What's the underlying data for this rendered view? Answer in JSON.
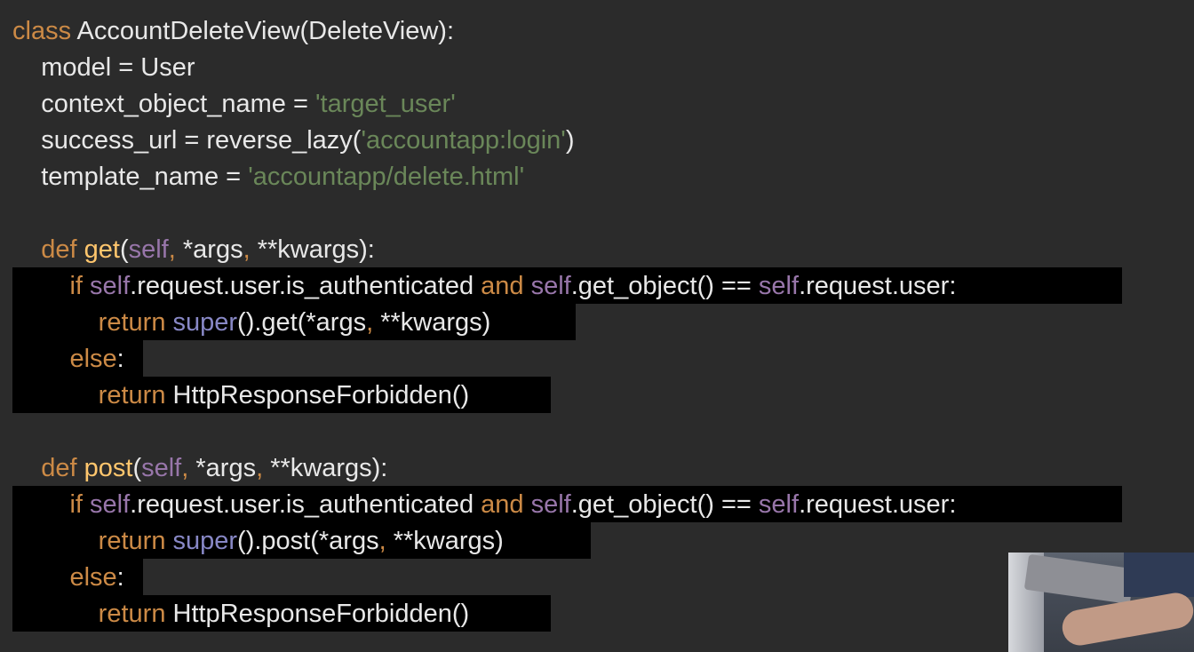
{
  "code_lines": [
    {
      "id": "l01",
      "tokens": [
        {
          "t": "class ",
          "c": "kw"
        },
        {
          "t": "AccountDeleteView(DeleteView):",
          "c": "txt"
        }
      ]
    },
    {
      "id": "l02",
      "tokens": [
        {
          "t": "    model = User",
          "c": "txt"
        }
      ]
    },
    {
      "id": "l03",
      "tokens": [
        {
          "t": "    context_object_name = ",
          "c": "txt"
        },
        {
          "t": "'target_user'",
          "c": "str"
        }
      ]
    },
    {
      "id": "l04",
      "tokens": [
        {
          "t": "    success_url = reverse_lazy(",
          "c": "txt"
        },
        {
          "t": "'accountapp:login'",
          "c": "str"
        },
        {
          "t": ")",
          "c": "txt"
        }
      ]
    },
    {
      "id": "l05",
      "tokens": [
        {
          "t": "    template_name = ",
          "c": "txt"
        },
        {
          "t": "'accountapp/delete.html'",
          "c": "str"
        }
      ]
    },
    {
      "id": "l06",
      "tokens": []
    },
    {
      "id": "l07",
      "tokens": [
        {
          "t": "    def ",
          "c": "kw"
        },
        {
          "t": "get",
          "c": "fn"
        },
        {
          "t": "(",
          "c": "txt"
        },
        {
          "t": "self",
          "c": "self"
        },
        {
          "t": ", ",
          "c": "pun"
        },
        {
          "t": "*args",
          "c": "txt"
        },
        {
          "t": ", ",
          "c": "pun"
        },
        {
          "t": "**kwargs):",
          "c": "txt"
        }
      ]
    },
    {
      "id": "l08",
      "tokens": [
        {
          "t": "        if ",
          "c": "kw"
        },
        {
          "t": "self",
          "c": "self"
        },
        {
          "t": ".request.user.is_authenticated ",
          "c": "txt"
        },
        {
          "t": "and ",
          "c": "kw"
        },
        {
          "t": "self",
          "c": "self"
        },
        {
          "t": ".get_object() == ",
          "c": "txt"
        },
        {
          "t": "self",
          "c": "self"
        },
        {
          "t": ".request.user:",
          "c": "txt"
        }
      ]
    },
    {
      "id": "l09",
      "tokens": [
        {
          "t": "            return ",
          "c": "kw"
        },
        {
          "t": "super",
          "c": "builtin"
        },
        {
          "t": "().get(*args",
          "c": "txt"
        },
        {
          "t": ", ",
          "c": "pun"
        },
        {
          "t": "**kwargs)",
          "c": "txt"
        }
      ]
    },
    {
      "id": "l10",
      "tokens": [
        {
          "t": "        else",
          "c": "kw"
        },
        {
          "t": ":",
          "c": "txt"
        }
      ]
    },
    {
      "id": "l11",
      "tokens": [
        {
          "t": "            return ",
          "c": "kw"
        },
        {
          "t": "HttpResponseForbidden()",
          "c": "txt"
        }
      ]
    },
    {
      "id": "l12",
      "tokens": []
    },
    {
      "id": "l13",
      "tokens": [
        {
          "t": "    def ",
          "c": "kw"
        },
        {
          "t": "post",
          "c": "fn"
        },
        {
          "t": "(",
          "c": "txt"
        },
        {
          "t": "self",
          "c": "self"
        },
        {
          "t": ", ",
          "c": "pun"
        },
        {
          "t": "*args",
          "c": "txt"
        },
        {
          "t": ", ",
          "c": "pun"
        },
        {
          "t": "**kwargs):",
          "c": "txt"
        }
      ]
    },
    {
      "id": "l14",
      "tokens": [
        {
          "t": "        if ",
          "c": "kw"
        },
        {
          "t": "self",
          "c": "self"
        },
        {
          "t": ".request.user.is_authenticated ",
          "c": "txt"
        },
        {
          "t": "and ",
          "c": "kw"
        },
        {
          "t": "self",
          "c": "self"
        },
        {
          "t": ".get_object() == ",
          "c": "txt"
        },
        {
          "t": "self",
          "c": "self"
        },
        {
          "t": ".request.user:",
          "c": "txt"
        }
      ]
    },
    {
      "id": "l15",
      "tokens": [
        {
          "t": "            return ",
          "c": "kw"
        },
        {
          "t": "super",
          "c": "builtin"
        },
        {
          "t": "().post(*args",
          "c": "txt"
        },
        {
          "t": ", ",
          "c": "pun"
        },
        {
          "t": "**kwargs)",
          "c": "txt"
        }
      ]
    },
    {
      "id": "l16",
      "tokens": [
        {
          "t": "        else",
          "c": "kw"
        },
        {
          "t": ":",
          "c": "txt"
        }
      ]
    },
    {
      "id": "l17",
      "tokens": [
        {
          "t": "            return ",
          "c": "kw"
        },
        {
          "t": "HttpResponseForbidden()",
          "c": "txt"
        }
      ]
    }
  ],
  "theme": {
    "background": "#2b2b2b",
    "selection": "#000000",
    "keyword": "#cc8a46",
    "function": "#ffc66d",
    "self": "#9876aa",
    "string": "#6a8759",
    "builtin": "#8888c6",
    "text": "#e8e8e8"
  }
}
